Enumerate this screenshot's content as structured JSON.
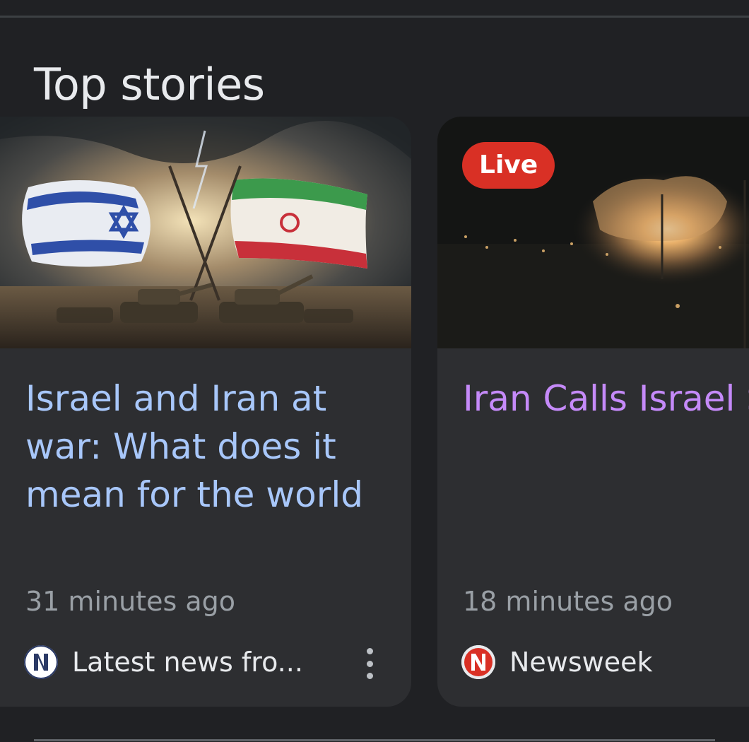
{
  "section": {
    "title": "Top stories"
  },
  "stories": [
    {
      "headline": "Israel and Iran at\nwar: What does it\nmean for the world",
      "time": "31 minutes ago",
      "source": "Latest news fro...",
      "source_icon": "newspaper-logo",
      "more_icon": "more-vert-icon"
    },
    {
      "badge": "Live",
      "headline": "Iran Calls Israel\nStrikes 'Declarat\nof War', Trump S\nHe Was Warned:",
      "time": "18 minutes ago",
      "source": "Newsweek",
      "source_icon": "newsweek-logo"
    }
  ],
  "colors": {
    "background": "#202124",
    "card": "#2d2e31",
    "headline_unvisited": "#a8c7fa",
    "headline_visited": "#c58af9",
    "live_badge": "#d93025",
    "meta_text": "#9aa0a6"
  }
}
